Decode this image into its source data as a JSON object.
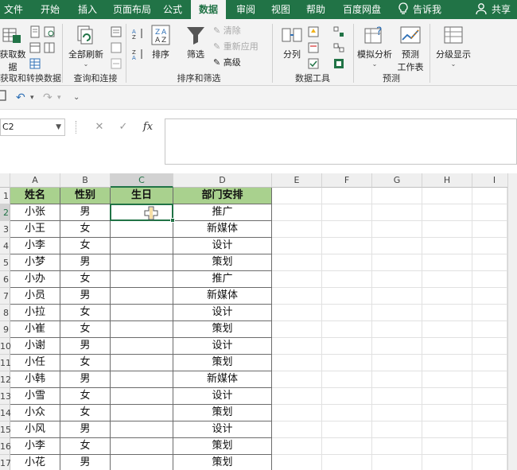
{
  "ribbon_tabs": [
    "文件",
    "开始",
    "插入",
    "页面布局",
    "公式",
    "数据",
    "审阅",
    "视图",
    "帮助",
    "百度网盘",
    "告诉我",
    "共享"
  ],
  "active_tab": "数据",
  "groups": {
    "get_data": {
      "label": "获取和转换数据",
      "button": "获取数据",
      "button_line1": "获取数",
      "button_line2": "据"
    },
    "queries": {
      "label": "查询和连接",
      "refresh_all": "全部刷新"
    },
    "sort_filter": {
      "label": "排序和筛选",
      "sort": "排序",
      "filter": "筛选",
      "clear": "清除",
      "reapply": "重新应用",
      "advanced": "高级"
    },
    "data_tools": {
      "label": "数据工具",
      "text_to_columns": "分列"
    },
    "forecast": {
      "label": "预测",
      "what_if": "模拟分析",
      "forecast_sheet_line1": "预测",
      "forecast_sheet_line2": "工作表"
    },
    "outline": {
      "label": "",
      "outline": "分级显示"
    }
  },
  "qat": {
    "undo": "↶",
    "redo": "↷"
  },
  "formula_bar": {
    "name_box": "C2",
    "cancel": "✕",
    "enter": "✓",
    "fx": "fx",
    "formula": ""
  },
  "colors": {
    "excel_green": "#217346",
    "header_fill": "#a9d18e"
  },
  "sheet": {
    "column_letters": [
      "A",
      "B",
      "C",
      "D",
      "E",
      "F",
      "G",
      "H",
      "I"
    ],
    "row_numbers": [
      "1",
      "2",
      "3",
      "4",
      "5",
      "6",
      "7",
      "8",
      "9",
      "10",
      "11",
      "12",
      "13",
      "14",
      "15",
      "16",
      "17"
    ],
    "active_cell": "C2",
    "headers": [
      "姓名",
      "性别",
      "生日",
      "部门安排"
    ],
    "rows": [
      [
        "小张",
        "男",
        "",
        "推广"
      ],
      [
        "小王",
        "女",
        "",
        "新媒体"
      ],
      [
        "小李",
        "女",
        "",
        "设计"
      ],
      [
        "小梦",
        "男",
        "",
        "策划"
      ],
      [
        "小办",
        "女",
        "",
        "推广"
      ],
      [
        "小员",
        "男",
        "",
        "新媒体"
      ],
      [
        "小拉",
        "女",
        "",
        "设计"
      ],
      [
        "小崔",
        "女",
        "",
        "策划"
      ],
      [
        "小谢",
        "男",
        "",
        "设计"
      ],
      [
        "小任",
        "女",
        "",
        "策划"
      ],
      [
        "小韩",
        "男",
        "",
        "新媒体"
      ],
      [
        "小雪",
        "女",
        "",
        "设计"
      ],
      [
        "小众",
        "女",
        "",
        "策划"
      ],
      [
        "小风",
        "男",
        "",
        "设计"
      ],
      [
        "小李",
        "女",
        "",
        "策划"
      ],
      [
        "小花",
        "男",
        "",
        "策划"
      ]
    ]
  }
}
